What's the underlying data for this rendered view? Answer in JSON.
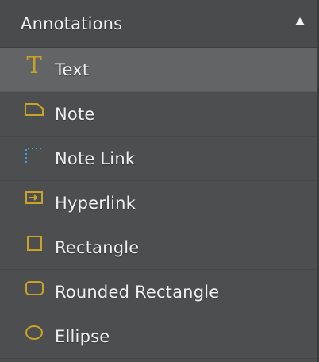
{
  "panel": {
    "title": "Annotations",
    "collapse_icon": "triangle-up-icon",
    "accent_color": "#c9a227",
    "link_color": "#3ea0d8",
    "tools": [
      {
        "label": "Text",
        "icon": "text-t-icon",
        "selected": true
      },
      {
        "label": "Note",
        "icon": "note-icon",
        "selected": false
      },
      {
        "label": "Note Link",
        "icon": "note-link-icon",
        "selected": false
      },
      {
        "label": "Hyperlink",
        "icon": "hyperlink-icon",
        "selected": false
      },
      {
        "label": "Rectangle",
        "icon": "rectangle-icon",
        "selected": false
      },
      {
        "label": "Rounded Rectangle",
        "icon": "rounded-rectangle-icon",
        "selected": false
      },
      {
        "label": "Ellipse",
        "icon": "ellipse-icon",
        "selected": false
      }
    ]
  }
}
